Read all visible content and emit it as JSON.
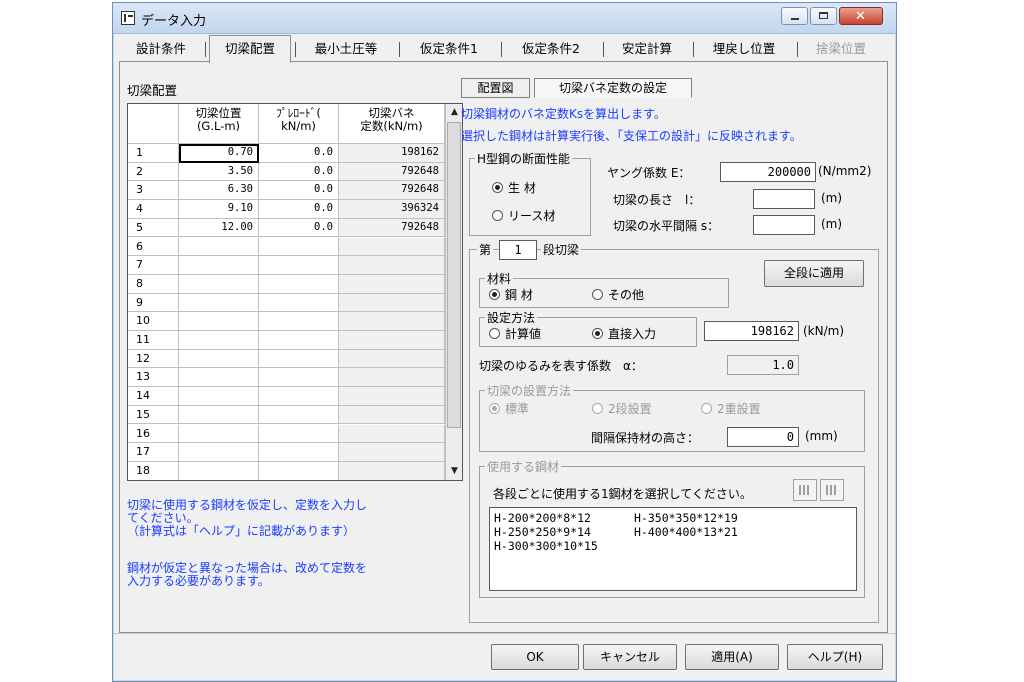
{
  "window": {
    "title": "データ入力"
  },
  "tabs": [
    {
      "label": "設計条件",
      "state": "normal"
    },
    {
      "label": "切梁配置",
      "state": "active"
    },
    {
      "label": "最小土圧等",
      "state": "normal"
    },
    {
      "label": "仮定条件1",
      "state": "normal"
    },
    {
      "label": "仮定条件2",
      "state": "normal"
    },
    {
      "label": "安定計算",
      "state": "normal"
    },
    {
      "label": "埋戻し位置",
      "state": "normal"
    },
    {
      "label": "捨梁位置",
      "state": "disabled"
    }
  ],
  "left": {
    "section_label": "切梁配置",
    "columns": [
      "切梁位置\n(G.L-m)",
      "ﾌﾟﾚﾛｰﾄﾞ(\nkN/m)",
      "切梁バネ\n定数(kN/m)"
    ],
    "rows": [
      {
        "no": "1",
        "pos": "0.70",
        "preload": "0.0",
        "spring": "198162"
      },
      {
        "no": "2",
        "pos": "3.50",
        "preload": "0.0",
        "spring": "792648"
      },
      {
        "no": "3",
        "pos": "6.30",
        "preload": "0.0",
        "spring": "792648"
      },
      {
        "no": "4",
        "pos": "9.10",
        "preload": "0.0",
        "spring": "396324"
      },
      {
        "no": "5",
        "pos": "12.00",
        "preload": "0.0",
        "spring": "792648"
      },
      {
        "no": "6",
        "pos": "",
        "preload": "",
        "spring": ""
      },
      {
        "no": "7",
        "pos": "",
        "preload": "",
        "spring": ""
      },
      {
        "no": "8",
        "pos": "",
        "preload": "",
        "spring": ""
      },
      {
        "no": "9",
        "pos": "",
        "preload": "",
        "spring": ""
      },
      {
        "no": "10",
        "pos": "",
        "preload": "",
        "spring": ""
      },
      {
        "no": "11",
        "pos": "",
        "preload": "",
        "spring": ""
      },
      {
        "no": "12",
        "pos": "",
        "preload": "",
        "spring": ""
      },
      {
        "no": "13",
        "pos": "",
        "preload": "",
        "spring": ""
      },
      {
        "no": "14",
        "pos": "",
        "preload": "",
        "spring": ""
      },
      {
        "no": "15",
        "pos": "",
        "preload": "",
        "spring": ""
      },
      {
        "no": "16",
        "pos": "",
        "preload": "",
        "spring": ""
      },
      {
        "no": "17",
        "pos": "",
        "preload": "",
        "spring": ""
      },
      {
        "no": "18",
        "pos": "",
        "preload": "",
        "spring": ""
      }
    ],
    "note1": "切梁に使用する鋼材を仮定し、定数を入力し\nてください。\n（計算式は「ヘルプ」に記載があります）",
    "note2": "鋼材が仮定と異なった場合は、改めて定数を\n入力する必要があります。"
  },
  "right": {
    "subtabs": [
      "配置図",
      "切梁バネ定数の設定"
    ],
    "desc1": "切梁鋼材のバネ定数Ksを算出します。",
    "desc2": "選択した鋼材は計算実行後、「支保工の設計」に反映されます。",
    "h_section": {
      "title": "H型鋼の断面性能",
      "opt1": "生 材",
      "opt2": "リース材",
      "selected": "生 材"
    },
    "young_label": "ヤング係数  E：",
    "young_value": "200000",
    "young_unit": "(N/mm2)",
    "length_label": "切梁の長さ　l：",
    "length_value": "",
    "length_unit": "(m)",
    "spacing_label": "切梁の水平間隔  s：",
    "spacing_value": "",
    "spacing_unit": "(m)",
    "stage": {
      "prefix": "第",
      "value": "1",
      "suffix": "段切梁"
    },
    "apply_all_label": "全段に適用",
    "material": {
      "title": "材料",
      "opt1": "鋼 材",
      "opt2": "その他",
      "selected": "鋼 材"
    },
    "method": {
      "title": "設定方法",
      "opt1": "計算値",
      "opt2": "直接入力",
      "selected": "直接入力",
      "value": "198162",
      "unit": "(kN/m)"
    },
    "slack_label": "切梁のゆるみを表す係数　α：",
    "slack_value": "1.0",
    "install": {
      "title": "切梁の設置方法",
      "opt1": "標準",
      "opt2": "2段設置",
      "opt3": "2重設置",
      "selected": "標準",
      "spacer_label": "間隔保持材の高さ：",
      "spacer_value": "0",
      "spacer_unit": "(mm)"
    },
    "steel": {
      "title": "使用する鋼材",
      "instruction": "各段ごとに使用する1鋼材を選択してください。",
      "items": [
        "H-200*200*8*12",
        "H-350*350*12*19",
        "H-250*250*9*14",
        "H-400*400*13*21",
        "H-300*300*10*15"
      ]
    }
  },
  "buttons": {
    "ok": "OK",
    "cancel": "キャンセル",
    "apply": "適用(A)",
    "help": "ヘルプ(H)"
  }
}
